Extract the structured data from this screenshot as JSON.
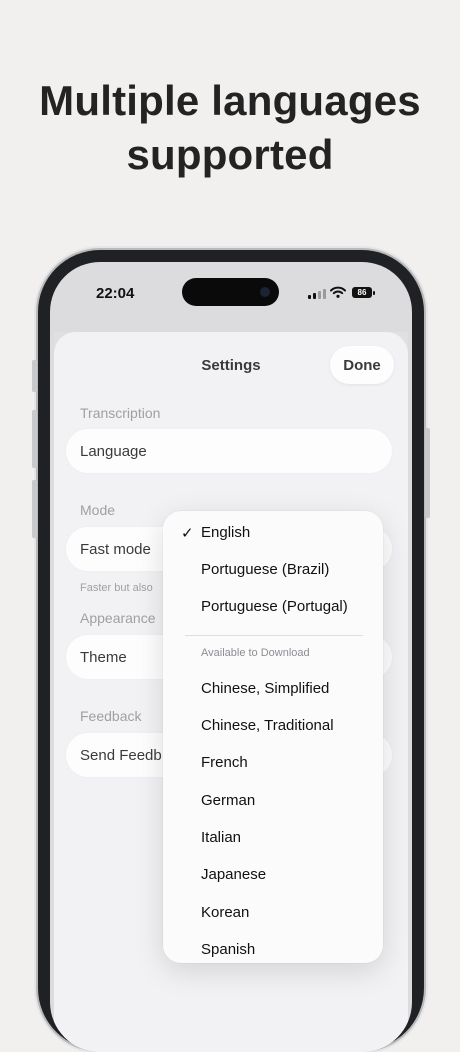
{
  "headline": {
    "line1": "Multiple languages",
    "line2": "supported"
  },
  "status_bar": {
    "time": "22:04",
    "battery": "86"
  },
  "sheet": {
    "title": "Settings",
    "done_label": "Done"
  },
  "sections": {
    "transcription": "Transcription",
    "mode": "Mode",
    "appearance": "Appearance",
    "feedback": "Feedback"
  },
  "rows": {
    "language": "Language",
    "fast_mode": "Fast mode",
    "fast_mode_footnote": "Faster but also",
    "theme": "Theme",
    "send_feedback": "Send Feedb"
  },
  "language_menu": {
    "check": "✓",
    "selected": "English",
    "installed": [
      "English",
      "Portuguese (Brazil)",
      "Portuguese (Portugal)"
    ],
    "download_header": "Available to Download",
    "available": [
      "Chinese, Simplified",
      "Chinese, Traditional",
      "French",
      "German",
      "Italian",
      "Japanese",
      "Korean",
      "Spanish"
    ]
  },
  "icons": [
    "signal-icon",
    "wifi-icon",
    "battery-icon",
    "checkmark-icon"
  ]
}
